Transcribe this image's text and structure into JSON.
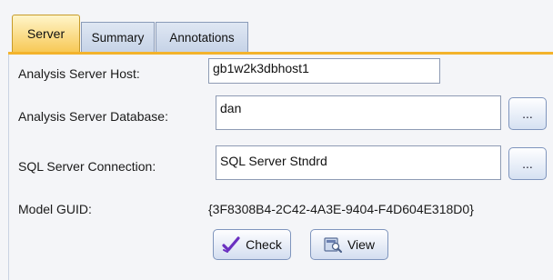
{
  "tabs": [
    {
      "label": "Server",
      "active": true
    },
    {
      "label": "Summary",
      "active": false
    },
    {
      "label": "Annotations",
      "active": false
    }
  ],
  "form": {
    "host_label": "Analysis Server Host:",
    "host_value": "gb1w2k3dbhost1",
    "database_label": "Analysis Server Database:",
    "database_value": "dan",
    "database_browse_label": "...",
    "connection_label": "SQL Server Connection:",
    "connection_value": "SQL Server Stndrd",
    "connection_browse_label": "...",
    "guid_label": "Model GUID:",
    "guid_value": "{3F8308B4-2C42-4A3E-9404-F4D604E318D0}"
  },
  "buttons": {
    "check_label": "Check",
    "view_label": "View"
  },
  "colors": {
    "active_tab": "#f7c957",
    "tab_underline": "#f3b32c",
    "check_icon": "#6a2fc0"
  },
  "icons": {
    "check": "checkmark-icon",
    "view": "view-model-icon"
  }
}
